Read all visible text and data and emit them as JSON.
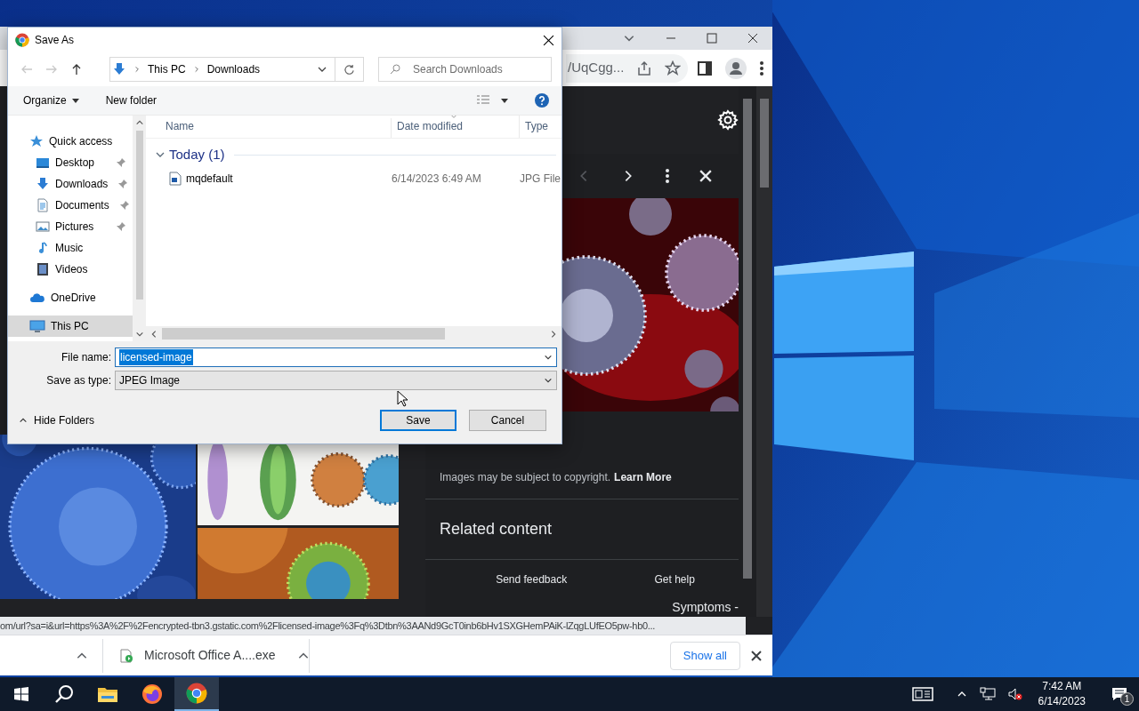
{
  "dialog": {
    "title": "Save As",
    "breadcrumb": [
      "This PC",
      "Downloads"
    ],
    "search": {
      "placeholder": "Search Downloads"
    },
    "toolbar": [
      "Organize",
      "New folder"
    ],
    "nav": [
      {
        "label": "Quick access",
        "kind": "star",
        "selected": false,
        "children": [
          {
            "label": "Desktop",
            "kind": "desktop",
            "pinned": true,
            "selected": false
          },
          {
            "label": "Downloads",
            "kind": "download",
            "pinned": true,
            "selected": false
          },
          {
            "label": "Documents",
            "kind": "document",
            "pinned": true,
            "selected": false
          },
          {
            "label": "Pictures",
            "kind": "pictures",
            "pinned": true,
            "selected": false
          },
          {
            "label": "Music",
            "kind": "music",
            "pinned": false,
            "selected": false
          },
          {
            "label": "Videos",
            "kind": "videos",
            "pinned": false,
            "selected": false
          }
        ]
      },
      {
        "label": "OneDrive",
        "kind": "cloud",
        "selected": false
      },
      {
        "label": "This PC",
        "kind": "pc",
        "selected": true
      }
    ],
    "columns": [
      "Name",
      "Date modified",
      "Type"
    ],
    "groups": [
      {
        "label": "Today (1)",
        "expanded": true,
        "files": [
          {
            "name": "mqdefault",
            "date": "6/14/2023 6:49 AM",
            "type": "JPG File"
          }
        ]
      }
    ],
    "file_name": {
      "label": "File name:",
      "value": "licensed-image"
    },
    "save_type": {
      "label": "Save as type:",
      "value": "JPEG Image"
    },
    "hide_folders": "Hide Folders",
    "buttons": [
      "Save",
      "Cancel"
    ]
  },
  "browser": {
    "url_fragment": "/UqCgg...",
    "viewer": {
      "copyright": "Images may be subject to copyright.",
      "learn_more": "Learn More",
      "related": "Related content",
      "footer": [
        "Send feedback",
        "Get help"
      ]
    },
    "page_fragment": "Symptoms -",
    "status_url": "om/url?sa=i&url=https%3A%2F%2Fencrypted-tbn3.gstatic.com%2Flicensed-image%3Fq%3Dtbn%3AANd9GcT0inb6bHv1SXGHemPAiK-lZqgLUfEO5pw-hb0...",
    "downloads": [
      {
        "name": "Microsoft Office A....exe"
      }
    ],
    "show_all": "Show all"
  },
  "taskbar": {
    "apps": [
      {
        "kind": "folder",
        "selected": false
      },
      {
        "kind": "firefox",
        "selected": false
      },
      {
        "kind": "chrome",
        "selected": true
      }
    ],
    "time": "7:42 AM",
    "date": "6/14/2023",
    "notifications": "1"
  }
}
